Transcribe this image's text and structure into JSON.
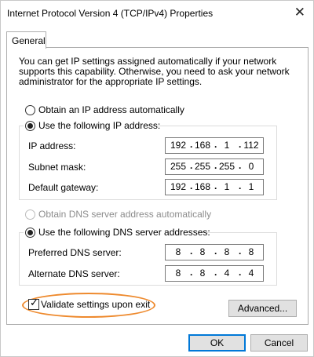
{
  "window": {
    "title": "Internet Protocol Version 4 (TCP/IPv4) Properties"
  },
  "tabs": [
    {
      "label": "General"
    }
  ],
  "description": "You can get IP settings assigned automatically if your network supports this capability. Otherwise, you need to ask your network administrator for the appropriate IP settings.",
  "ip": {
    "auto_label": "Obtain an IP address automatically",
    "manual_label": "Use the following IP address:",
    "selected": "manual",
    "fields": {
      "address": {
        "label": "IP address:",
        "octets": [
          "192",
          "168",
          "1",
          "112"
        ]
      },
      "mask": {
        "label": "Subnet mask:",
        "octets": [
          "255",
          "255",
          "255",
          "0"
        ]
      },
      "gateway": {
        "label": "Default gateway:",
        "octets": [
          "192",
          "168",
          "1",
          "1"
        ]
      }
    }
  },
  "dns": {
    "auto_label": "Obtain DNS server address automatically",
    "manual_label": "Use the following DNS server addresses:",
    "selected": "manual",
    "fields": {
      "preferred": {
        "label": "Preferred DNS server:",
        "octets": [
          "8",
          "8",
          "8",
          "8"
        ]
      },
      "alternate": {
        "label": "Alternate DNS server:",
        "octets": [
          "8",
          "8",
          "4",
          "4"
        ]
      }
    }
  },
  "validate": {
    "label": "Validate settings upon exit",
    "checked": true
  },
  "buttons": {
    "advanced": "Advanced...",
    "ok": "OK",
    "cancel": "Cancel"
  },
  "colors": {
    "highlight": "#ee8a2e",
    "default_button_border": "#0078d7",
    "button_face": "#e1e1e1"
  }
}
